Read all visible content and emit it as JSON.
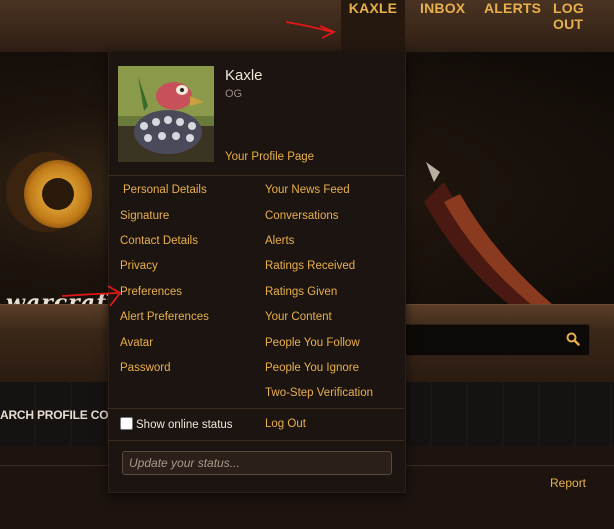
{
  "topnav": {
    "items": [
      {
        "label": "KAXLE"
      },
      {
        "label": "INBOX"
      },
      {
        "label": "ALERTS"
      },
      {
        "label": "LOG OUT"
      }
    ]
  },
  "banner": {
    "subtitle": "warcraft"
  },
  "subnav": {
    "label": "ARCH PROFILE CONTENT"
  },
  "content": {
    "report_label": "Report"
  },
  "user_menu": {
    "name": "Kaxle",
    "title": "OG",
    "profile_link": "Your Profile Page",
    "left_links": [
      "Personal Details",
      "Signature",
      "Contact Details",
      "Privacy",
      "Preferences",
      "Alert Preferences",
      "Avatar",
      "Password"
    ],
    "right_links": [
      "Your News Feed",
      "Conversations",
      "Alerts",
      "Ratings Received",
      "Ratings Given",
      "Your Content",
      "People You Follow",
      "People You Ignore",
      "Two-Step Verification"
    ],
    "show_online_status": "Show online status",
    "show_online_checked": false,
    "logout": "Log Out",
    "status_placeholder": "Update your status..."
  },
  "colors": {
    "accent": "#e8b04a",
    "menu_bg": "#1c1410",
    "annotation": "#e01818"
  }
}
